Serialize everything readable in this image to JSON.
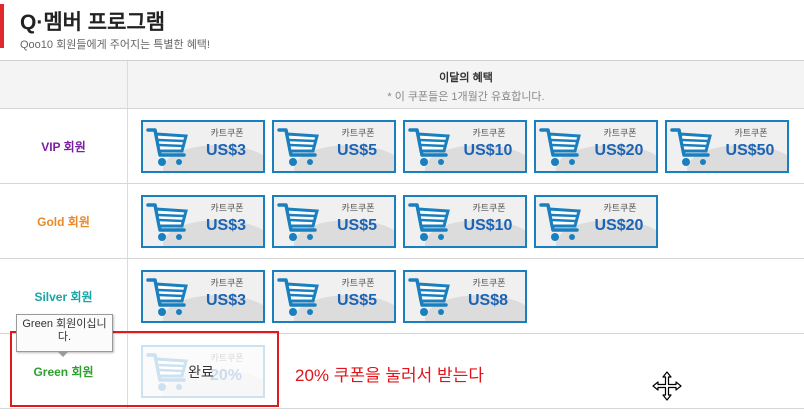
{
  "header": {
    "title": "Q·멤버 프로그램",
    "subtitle": "Qoo10 회원들에게 주어지는 특별한 혜택!"
  },
  "table": {
    "header_title": "이달의 혜택",
    "header_note": "* 이 쿠폰들은 1개월간 유효합니다."
  },
  "coupon_type": "카트쿠폰",
  "tiers": [
    {
      "label": "VIP 회원",
      "color": "#7a1fa2",
      "coupons": [
        "US$3",
        "US$5",
        "US$10",
        "US$20",
        "US$50"
      ]
    },
    {
      "label": "Gold 회원",
      "color": "#e8892a",
      "coupons": [
        "US$3",
        "US$5",
        "US$10",
        "US$20"
      ]
    },
    {
      "label": "Silver 회원",
      "color": "#1aa5a5",
      "coupons": [
        "US$3",
        "US$5",
        "US$8"
      ]
    },
    {
      "label": "Green 회원",
      "color": "#2ea02e",
      "coupons": [
        "20%"
      ]
    }
  ],
  "green_coupon_status": "완료",
  "tooltip_text": "Green 회원이십니다.",
  "annotation": "20% 쿠폰을 눌러서 받는다",
  "colors": {
    "accent": "#e0282e",
    "coupon_border": "#1a7fbf",
    "coupon_amount": "#1b63b5",
    "highlight": "#e01a1a"
  },
  "icons": {
    "coupon": "shopping-cart-icon",
    "cursor": "move-cursor-icon"
  }
}
